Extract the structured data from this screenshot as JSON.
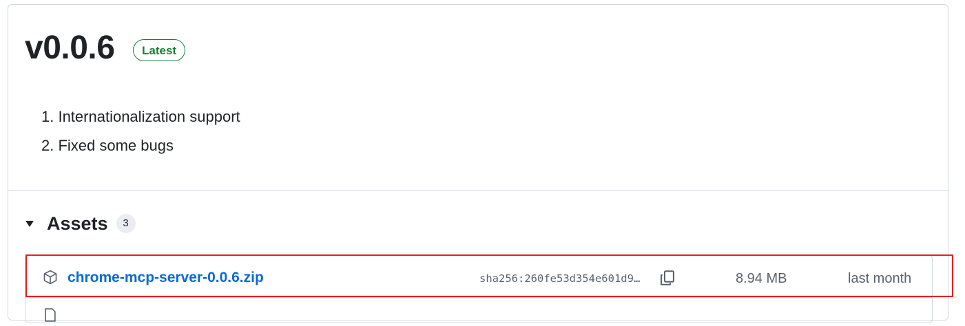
{
  "release": {
    "version": "v0.0.6",
    "badge": "Latest",
    "notes": [
      "1. Internationalization support",
      "2. Fixed some bugs"
    ]
  },
  "assets": {
    "title": "Assets",
    "count": "3",
    "items": [
      {
        "icon": "package-icon",
        "name": "chrome-mcp-server-0.0.6.zip",
        "sha": "sha256:260fe53d354e601d9…",
        "size": "8.94 MB",
        "date": "last month"
      }
    ]
  },
  "colors": {
    "link": "#0969da",
    "badge": "#1a7f37",
    "highlight": "#e8201f",
    "muted": "#59636e"
  }
}
